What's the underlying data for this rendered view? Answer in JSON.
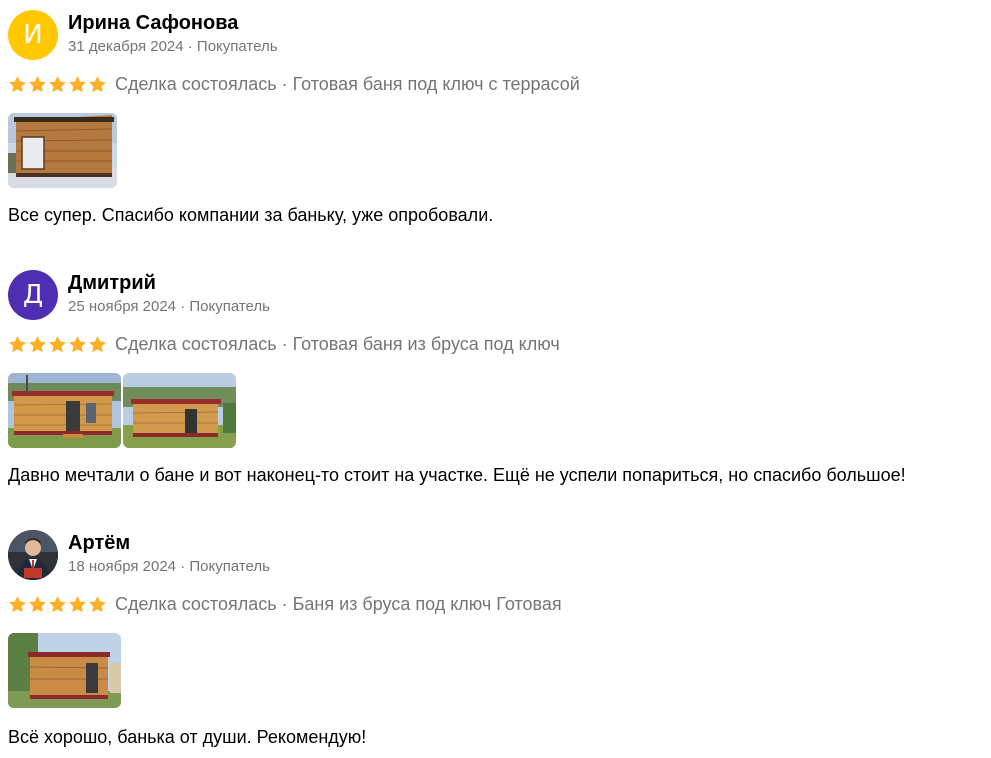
{
  "colors": {
    "star": "#FFB021",
    "meta_text": "#757575",
    "avatar_irina": "#FFC800",
    "avatar_dmitry": "#4E2EB2"
  },
  "reviews": [
    {
      "avatar_letter": "И",
      "name": "Ирина Сафонова",
      "meta": "31 декабря 2024 · Покупатель",
      "stars": 5,
      "rating_text": "Сделка состоялась · Готовая баня под ключ с террасой",
      "photo_count": 1,
      "comment": "Все супер. Спасибо компании за баньку, уже опробовали."
    },
    {
      "avatar_letter": "Д",
      "name": "Дмитрий",
      "meta": "25 ноября 2024 · Покупатель",
      "stars": 5,
      "rating_text": "Сделка состоялась · Готовая баня из бруса под ключ",
      "photo_count": 2,
      "comment": "Давно мечтали о бане и вот наконец-то стоит на участке. Ещё не успели попариться, но спасибо большое!"
    },
    {
      "avatar_letter": "",
      "name": "Артём",
      "meta": "18 ноября 2024 · Покупатель",
      "stars": 5,
      "rating_text": "Сделка состоялась · Баня из бруса под ключ Готовая",
      "photo_count": 1,
      "comment": "Всё хорошо, банька от души. Рекомендую!"
    }
  ]
}
